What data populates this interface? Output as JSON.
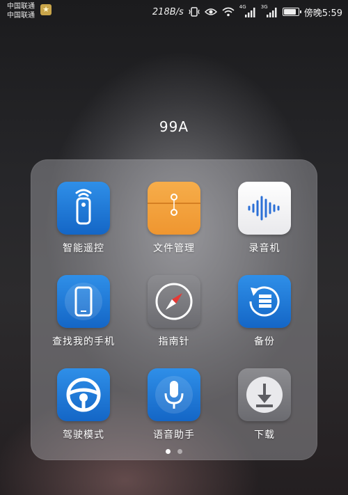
{
  "status_bar": {
    "carrier_1": "中国联通",
    "carrier_2": "中国联通",
    "speed": "218B/s",
    "net_1": "4G",
    "net_2": "3G",
    "time": "傍晚5:59",
    "battery_level": 0.85
  },
  "folder": {
    "title": "99A",
    "apps": [
      {
        "label": "智能遥控",
        "icon": "remote-control-icon"
      },
      {
        "label": "文件管理",
        "icon": "file-manager-icon"
      },
      {
        "label": "录音机",
        "icon": "sound-recorder-icon"
      },
      {
        "label": "查找我的手机",
        "icon": "find-my-phone-icon"
      },
      {
        "label": "指南针",
        "icon": "compass-icon"
      },
      {
        "label": "备份",
        "icon": "backup-icon"
      },
      {
        "label": "驾驶模式",
        "icon": "driving-mode-icon"
      },
      {
        "label": "语音助手",
        "icon": "voice-assistant-icon"
      },
      {
        "label": "下载",
        "icon": "download-icon"
      }
    ],
    "page_count": 2,
    "current_page": 1
  }
}
